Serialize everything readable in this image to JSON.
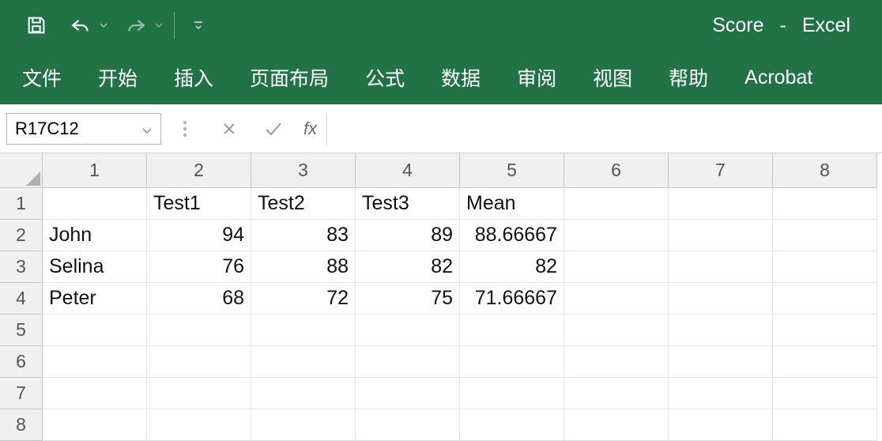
{
  "title": {
    "doc_name": "Score",
    "separator": "-",
    "app_name": "Excel"
  },
  "tabs": [
    "文件",
    "开始",
    "插入",
    "页面布局",
    "公式",
    "数据",
    "审阅",
    "视图",
    "帮助",
    "Acrobat"
  ],
  "name_box": "R17C12",
  "formula_value": "",
  "column_headers": [
    "1",
    "2",
    "3",
    "4",
    "5",
    "6",
    "7",
    "8"
  ],
  "row_headers": [
    "1",
    "2",
    "3",
    "4",
    "5",
    "6",
    "7",
    "8"
  ],
  "grid": {
    "r1": {
      "c1": "",
      "c2": "Test1",
      "c3": "Test2",
      "c4": "Test3",
      "c5": "Mean",
      "c6": "",
      "c7": "",
      "c8": ""
    },
    "r2": {
      "c1": "John",
      "c2": "94",
      "c3": "83",
      "c4": "89",
      "c5": "88.66667",
      "c6": "",
      "c7": "",
      "c8": ""
    },
    "r3": {
      "c1": "Selina",
      "c2": "76",
      "c3": "88",
      "c4": "82",
      "c5": "82",
      "c6": "",
      "c7": "",
      "c8": ""
    },
    "r4": {
      "c1": "Peter",
      "c2": "68",
      "c3": "72",
      "c4": "75",
      "c5": "71.66667",
      "c6": "",
      "c7": "",
      "c8": ""
    },
    "r5": {
      "c1": "",
      "c2": "",
      "c3": "",
      "c4": "",
      "c5": "",
      "c6": "",
      "c7": "",
      "c8": ""
    },
    "r6": {
      "c1": "",
      "c2": "",
      "c3": "",
      "c4": "",
      "c5": "",
      "c6": "",
      "c7": "",
      "c8": ""
    },
    "r7": {
      "c1": "",
      "c2": "",
      "c3": "",
      "c4": "",
      "c5": "",
      "c6": "",
      "c7": "",
      "c8": ""
    },
    "r8": {
      "c1": "",
      "c2": "",
      "c3": "",
      "c4": "",
      "c5": "",
      "c6": "",
      "c7": "",
      "c8": ""
    }
  },
  "chart_data": {
    "type": "table",
    "title": "Score",
    "columns": [
      "",
      "Test1",
      "Test2",
      "Test3",
      "Mean"
    ],
    "rows": [
      {
        "name": "John",
        "Test1": 94,
        "Test2": 83,
        "Test3": 89,
        "Mean": 88.66667
      },
      {
        "name": "Selina",
        "Test1": 76,
        "Test2": 88,
        "Test3": 82,
        "Mean": 82
      },
      {
        "name": "Peter",
        "Test1": 68,
        "Test2": 72,
        "Test3": 75,
        "Mean": 71.66667
      }
    ]
  }
}
